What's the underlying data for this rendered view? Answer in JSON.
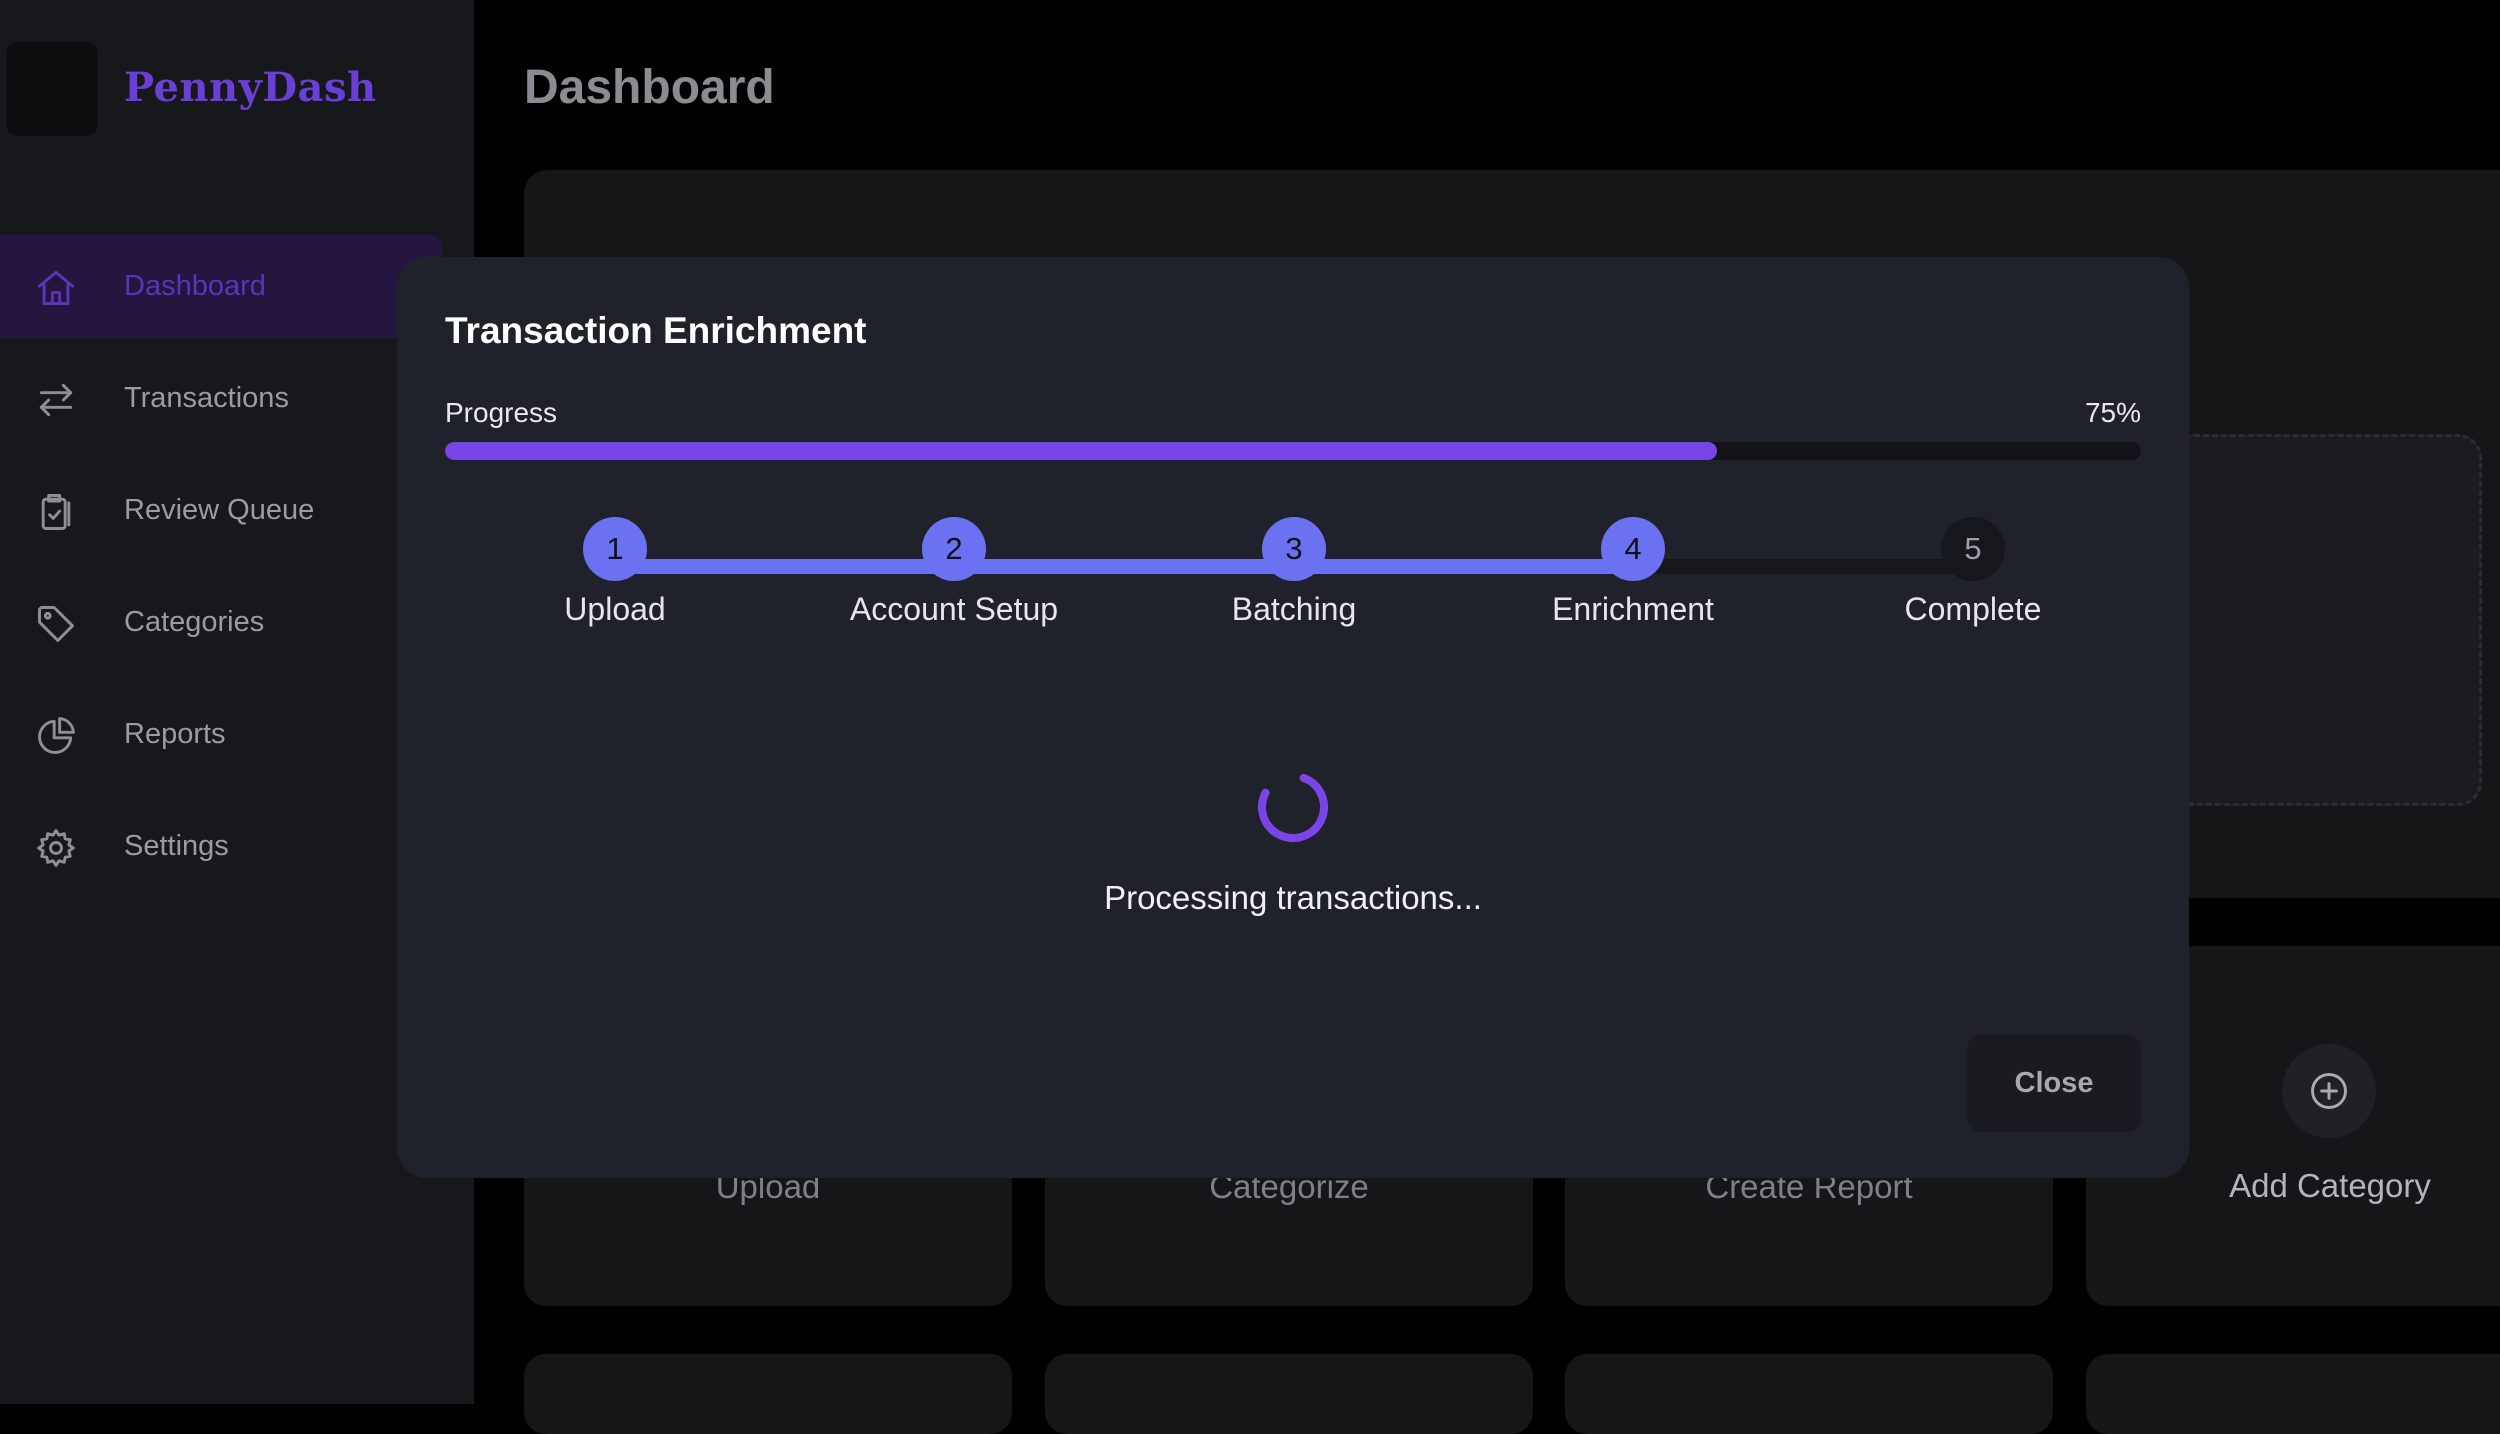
{
  "app": {
    "brand": "PennyDash"
  },
  "sidebar": {
    "items": [
      {
        "label": "Dashboard",
        "icon": "home-icon",
        "active": true
      },
      {
        "label": "Transactions",
        "icon": "arrows-swap-icon",
        "active": false
      },
      {
        "label": "Review Queue",
        "icon": "clipboard-check-icon",
        "active": false
      },
      {
        "label": "Categories",
        "icon": "tag-icon",
        "active": false
      },
      {
        "label": "Reports",
        "icon": "pie-chart-icon",
        "active": false
      },
      {
        "label": "Settings",
        "icon": "gear-icon",
        "active": false
      }
    ]
  },
  "main": {
    "title": "Dashboard",
    "actions": [
      {
        "label": "Upload"
      },
      {
        "label": "Categorize"
      },
      {
        "label": "Create Report"
      },
      {
        "label": "Add Category",
        "icon": "plus-circle-icon"
      }
    ]
  },
  "modal": {
    "title": "Transaction Enrichment",
    "progress_label": "Progress",
    "progress_text": "75%",
    "progress_value": 0.75,
    "steps": [
      {
        "number": "1",
        "label": "Upload",
        "state": "done"
      },
      {
        "number": "2",
        "label": "Account Setup",
        "state": "done"
      },
      {
        "number": "3",
        "label": "Batching",
        "state": "done"
      },
      {
        "number": "4",
        "label": "Enrichment",
        "state": "current"
      },
      {
        "number": "5",
        "label": "Complete",
        "state": "todo"
      }
    ],
    "status_text": "Processing transactions...",
    "close_label": "Close"
  },
  "colors": {
    "accent": "#7a45e6",
    "step_done": "#6b72f2",
    "brand": "#6a3fd8"
  }
}
